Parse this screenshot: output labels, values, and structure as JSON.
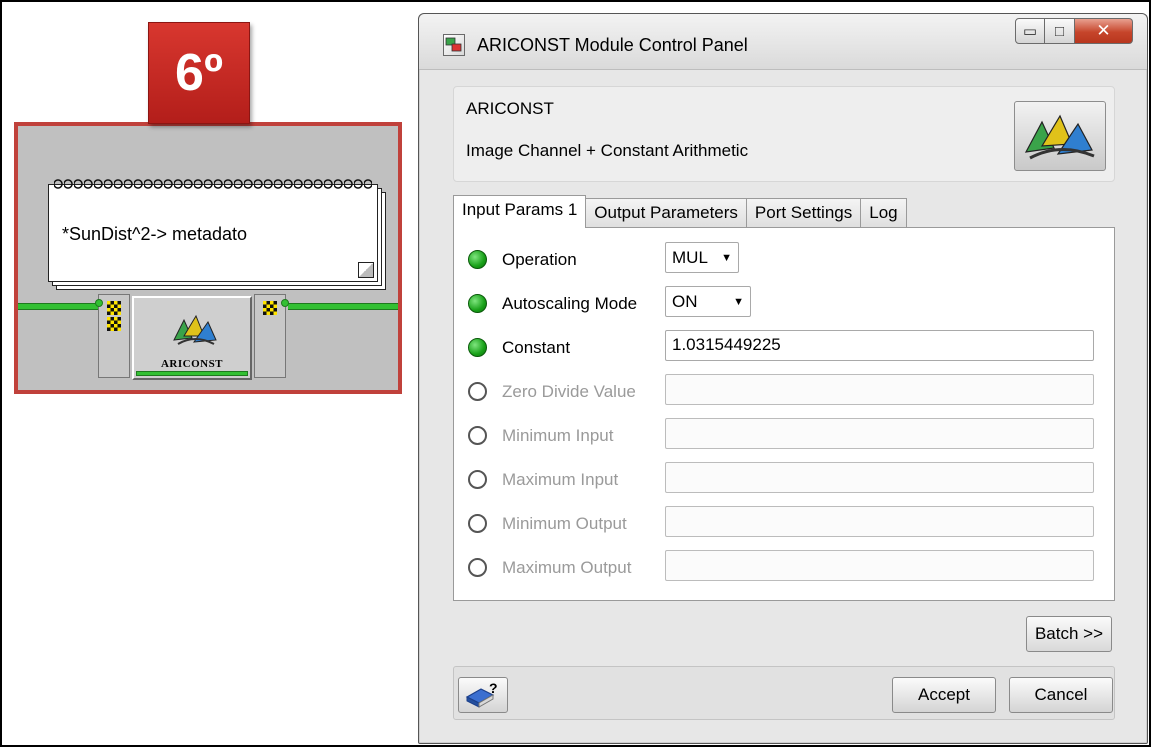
{
  "badge": {
    "text": "6º"
  },
  "workflow": {
    "note_text": "*SunDist^2-> metadato",
    "module_label": "ARICONST"
  },
  "window": {
    "title": "ARICONST Module Control Panel",
    "controls": {
      "minimize": "▭",
      "maximize": "□",
      "close": "✕"
    }
  },
  "header": {
    "module_name": "ARICONST",
    "description": "Image Channel + Constant Arithmetic"
  },
  "tabs": [
    {
      "label": "Input Params 1",
      "active": true
    },
    {
      "label": "Output Parameters",
      "active": false
    },
    {
      "label": "Port Settings",
      "active": false
    },
    {
      "label": "Log",
      "active": false
    }
  ],
  "params": [
    {
      "label": "Operation",
      "enabled": true,
      "type": "select",
      "value": "MUL"
    },
    {
      "label": "Autoscaling Mode",
      "enabled": true,
      "type": "select",
      "value": "ON"
    },
    {
      "label": "Constant",
      "enabled": true,
      "type": "text",
      "value": "1.0315449225"
    },
    {
      "label": "Zero Divide Value",
      "enabled": false,
      "type": "text",
      "value": ""
    },
    {
      "label": "Minimum Input",
      "enabled": false,
      "type": "text",
      "value": ""
    },
    {
      "label": "Maximum Input",
      "enabled": false,
      "type": "text",
      "value": ""
    },
    {
      "label": "Minimum Output",
      "enabled": false,
      "type": "text",
      "value": ""
    },
    {
      "label": "Maximum Output",
      "enabled": false,
      "type": "text",
      "value": ""
    }
  ],
  "buttons": {
    "batch": "Batch >>",
    "accept": "Accept",
    "cancel": "Cancel",
    "help": "?"
  },
  "colors": {
    "badge_red": "#c8302a",
    "pipe_green": "#33c033",
    "led_on": "#18a018"
  }
}
